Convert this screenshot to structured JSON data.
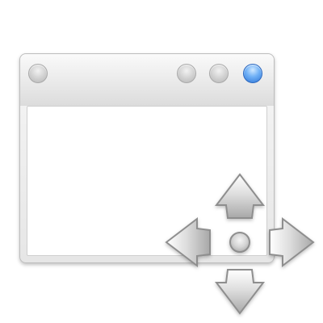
{
  "icons": {
    "window": "window-icon",
    "move_cursor": "move-cursor-icon"
  },
  "colors": {
    "accent_blue": "#2f76d6",
    "button_gray": "#cfcfcf",
    "window_bg": "#e6e6e6",
    "content_bg": "#ffffff"
  }
}
